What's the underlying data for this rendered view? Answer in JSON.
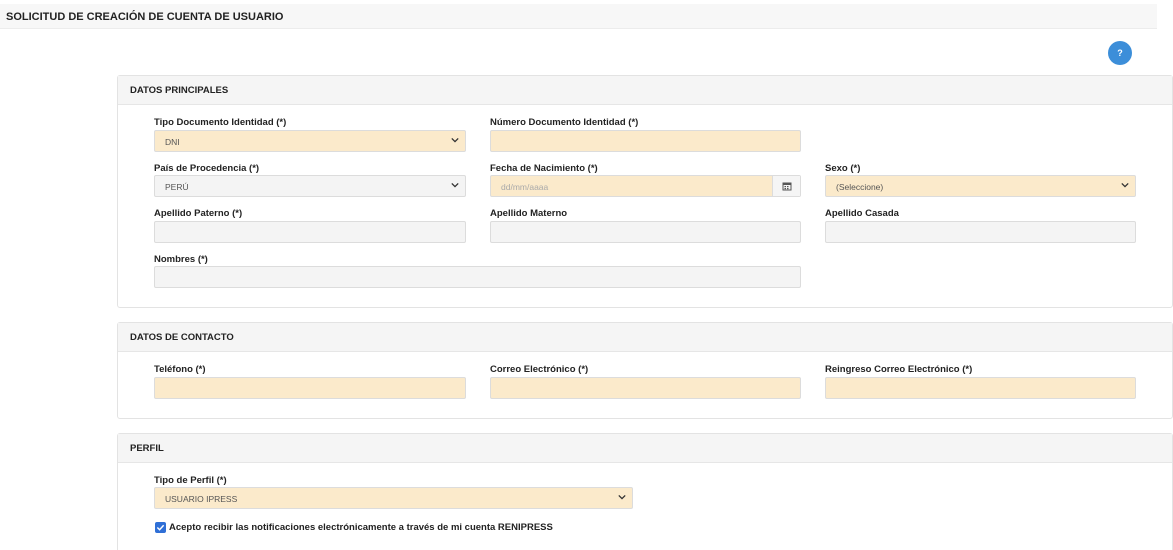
{
  "page": {
    "title": "SOLICITUD DE CREACIÓN DE CUENTA DE USUARIO",
    "help_label": "?"
  },
  "datos_principales": {
    "heading": "DATOS PRINCIPALES",
    "tipo_documento": {
      "label": "Tipo Documento Identidad (*)",
      "value": "DNI"
    },
    "numero_documento": {
      "label": "Número Documento Identidad (*)",
      "value": ""
    },
    "pais": {
      "label": "País de Procedencia (*)",
      "value": "PERÚ"
    },
    "fecha_nacimiento": {
      "label": "Fecha de Nacimiento (*)",
      "placeholder": "dd/mm/aaaa"
    },
    "sexo": {
      "label": "Sexo (*)",
      "value": "(Seleccione)"
    },
    "apellido_paterno": {
      "label": "Apellido Paterno (*)",
      "value": ""
    },
    "apellido_materno": {
      "label": "Apellido Materno",
      "value": ""
    },
    "apellido_casada": {
      "label": "Apellido Casada",
      "value": ""
    },
    "nombres": {
      "label": "Nombres (*)",
      "value": ""
    }
  },
  "datos_contacto": {
    "heading": "DATOS DE CONTACTO",
    "telefono": {
      "label": "Teléfono (*)",
      "value": ""
    },
    "correo": {
      "label": "Correo Electrónico (*)",
      "value": ""
    },
    "reingreso_correo": {
      "label": "Reingreso Correo Electrónico (*)",
      "value": ""
    }
  },
  "perfil": {
    "heading": "PERFIL",
    "tipo_perfil": {
      "label": "Tipo de Perfil (*)",
      "value": "USUARIO IPRESS"
    },
    "acepto": {
      "label": "Acepto recibir las notificaciones electrónicamente a través de mi cuenta RENIPRESS",
      "checked": true
    }
  },
  "colors": {
    "input_yellow": "#fbeacb",
    "input_gray": "#f4f4f4",
    "accent": "#3c8ed9"
  }
}
